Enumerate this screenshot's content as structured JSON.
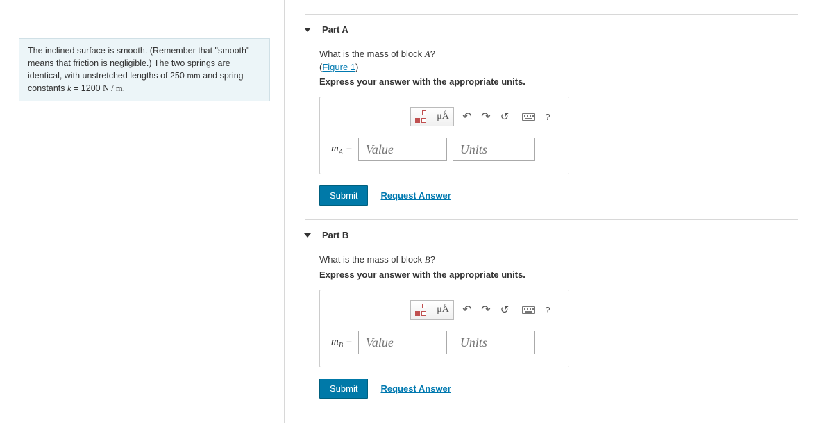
{
  "problem": {
    "text_prefix": "The inclined surface is smooth. (Remember that \"smooth\" means that friction is negligible.) The two springs are identical, with unstretched lengths of 250 ",
    "len_unit": "mm",
    "text_mid": " and spring constants ",
    "k_sym": "k",
    "eq": " = 1200 ",
    "force_unit": "N / m",
    "text_end": "."
  },
  "toolbar": {
    "units_symbol": "μÅ",
    "help": "?"
  },
  "placeholders": {
    "value": "Value",
    "units": "Units"
  },
  "buttons": {
    "submit": "Submit",
    "request": "Request Answer"
  },
  "partA": {
    "title": "Part A",
    "q_prefix": "What is the mass of block ",
    "q_var": "A",
    "q_suffix": "?",
    "figure": "Figure 1",
    "instr": "Express your answer with the appropriate units.",
    "var_base": "m",
    "var_sub": "A",
    "var_eq": " ="
  },
  "partB": {
    "title": "Part B",
    "q_prefix": "What is the mass of block ",
    "q_var": "B",
    "q_suffix": "?",
    "instr": "Express your answer with the appropriate units.",
    "var_base": "m",
    "var_sub": "B",
    "var_eq": " ="
  }
}
